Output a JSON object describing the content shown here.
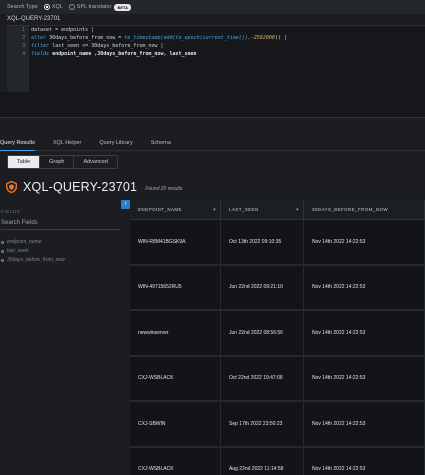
{
  "search_type": {
    "label": "Search Type",
    "options": [
      {
        "label": "XQL",
        "selected": true
      },
      {
        "label": "SPL translator",
        "selected": false,
        "badge": "BETA"
      }
    ]
  },
  "query_name": "XQL-QUERY-23701",
  "editor": {
    "line_numbers": [
      "1",
      "2",
      "3",
      "4"
    ],
    "lines": {
      "l1": "dataset = endpoints |",
      "l2a": "alter",
      "l2b": " 30days_before_from_now = ",
      "l2c": "to_timestamp(add(to_epoch(current_time()),",
      "l2d": "-2592000",
      "l2e": ")) |",
      "l3a": "filter",
      "l3b": " last_seen <= 30days_before_from_now |",
      "l4a": "fields",
      "l4b": " endpoint_name ,30days_before_from_now, last_seen"
    }
  },
  "tabs": [
    "Query Results",
    "XQL Helper",
    "Query Library",
    "Schema"
  ],
  "active_tab": "Query Results",
  "view_tabs": [
    "Table",
    "Graph",
    "Advanced"
  ],
  "active_view": "Table",
  "results_title": "XQL-QUERY-23701",
  "results_count": "Found 20 results",
  "fields_panel": {
    "heading": "FIELDS",
    "search_placeholder": "Search Fields",
    "fields": [
      "endpoint_name",
      "last_seen",
      "30days_before_from_now"
    ]
  },
  "collapse_icon": "chevron-left-icon",
  "table": {
    "columns": [
      "ENDPOINT_NAME",
      "LAST_SEEN",
      "30DAYS_BEFORE_FROM_NOW"
    ],
    "rows": [
      [
        "WIN-R8M41BGSK9A",
        "Oct 13th 2022 09:10:35",
        "Nov 14th 2022 14:22:53"
      ],
      [
        "WIN-49715652RU5",
        "Jun 22nd 2022 09:21:10",
        "Nov 14th 2022 14:22:53"
      ],
      [
        "newwinserver",
        "Jun 22nd 2022 08:56:56",
        "Nov 14th 2022 14:22:53"
      ],
      [
        "CXJ-WSBLACK",
        "Oct 22nd 2022 19:47:08",
        "Nov 14th 2022 14:22:53"
      ],
      [
        "CXJ-SBWIN",
        "Sep 17th 2022 23:50:23",
        "Nov 14th 2022 14:22:53"
      ],
      [
        "CXJ-WSBLACK",
        "Aug 22nd 2022 11:14:58",
        "Nov 14th 2022 14:22:53"
      ]
    ]
  },
  "colors": {
    "accent": "#4aa0e6",
    "background": "#1b1d20",
    "table_bg": "#121417",
    "logo": "#e8732a"
  }
}
